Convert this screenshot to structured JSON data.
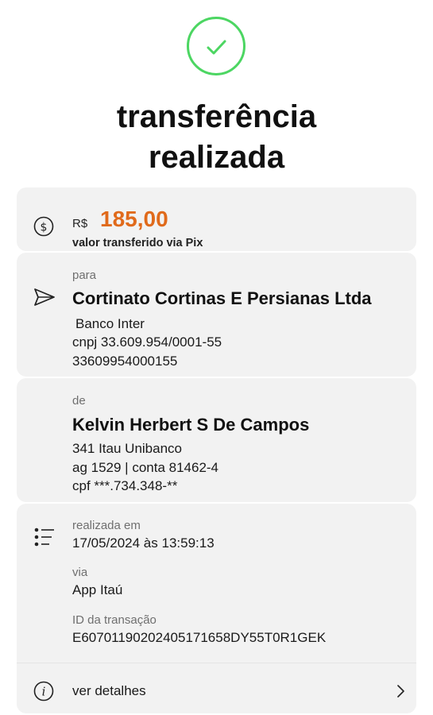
{
  "header": {
    "icon": "checkmark-circle-icon",
    "title_line1": "transferência",
    "title_line2": "realizada"
  },
  "amount_card": {
    "icon": "dollar-circle-icon",
    "currency": "R$",
    "value": "185,00",
    "caption": "valor transferido via Pix"
  },
  "recipient": {
    "icon": "send-arrow-icon",
    "label": "para",
    "name": "Cortinato Cortinas E Persianas Ltda",
    "bank": "Banco Inter",
    "cnpj": "cnpj 33.609.954/0001-55",
    "key": "33609954000155"
  },
  "sender": {
    "label": "de",
    "name": "Kelvin Herbert S De Campos",
    "bank": "341 Itau Unibanco",
    "account": "ag 1529 | conta 81462-4",
    "cpf": "cpf ***.734.348-**"
  },
  "details": {
    "icon": "list-icon",
    "date_label": "realizada em",
    "date_value": "17/05/2024 às 13:59:13",
    "via_label": "via",
    "via_value": "App Itaú",
    "id_label": "ID da transação",
    "id_value": "E60701190202405171658DY55T0R1GEK"
  },
  "more": {
    "icon": "info-circle-icon",
    "label": "ver detalhes",
    "chevron": "chevron-right-icon"
  },
  "colors": {
    "accent": "#e06a1b",
    "success": "#4cd662",
    "card_bg": "#f2f2f2"
  }
}
